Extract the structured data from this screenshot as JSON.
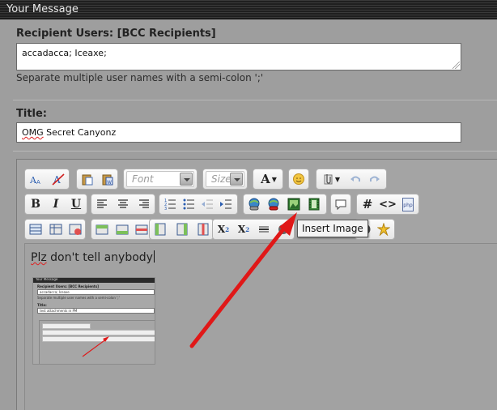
{
  "panel": {
    "title": "Your Message"
  },
  "recipients": {
    "label": "Recipient Users:",
    "bcc_link": "[BCC Recipients]",
    "value": "accadacca; Iceaxe;",
    "hint": "Separate multiple user names with a semi-colon ';'"
  },
  "title_field": {
    "label": "Title:",
    "value_misspelled": "OMG",
    "value_rest": " Secret Canyonz"
  },
  "toolbar": {
    "font_placeholder": "Font",
    "size_placeholder": "Size",
    "font_color_letter": "A",
    "bold": "B",
    "italic": "I",
    "underline": "U",
    "hash": "#",
    "code": "<>",
    "php": "php",
    "subscript": "X",
    "subscript_mark": "2",
    "superscript": "X",
    "superscript_mark": "2",
    "tooltip": "Insert Image"
  },
  "editor": {
    "body_misspelled": "Plz",
    "body_rest": " don't tell anybody"
  },
  "thumbnail": {
    "header": "Your Message",
    "recipients_label": "Recipient Users: [BCC Recipients]",
    "recipients_value": "accadacca; Iceaxe",
    "hint": "Separate multiple user names with a semi-colon ';'",
    "title_label": "Title:",
    "title_value": "test attachments in PM"
  },
  "colors": {
    "annotation_arrow": "#e01818",
    "page_background": "#9e9e9e",
    "header_background": "#222222"
  }
}
